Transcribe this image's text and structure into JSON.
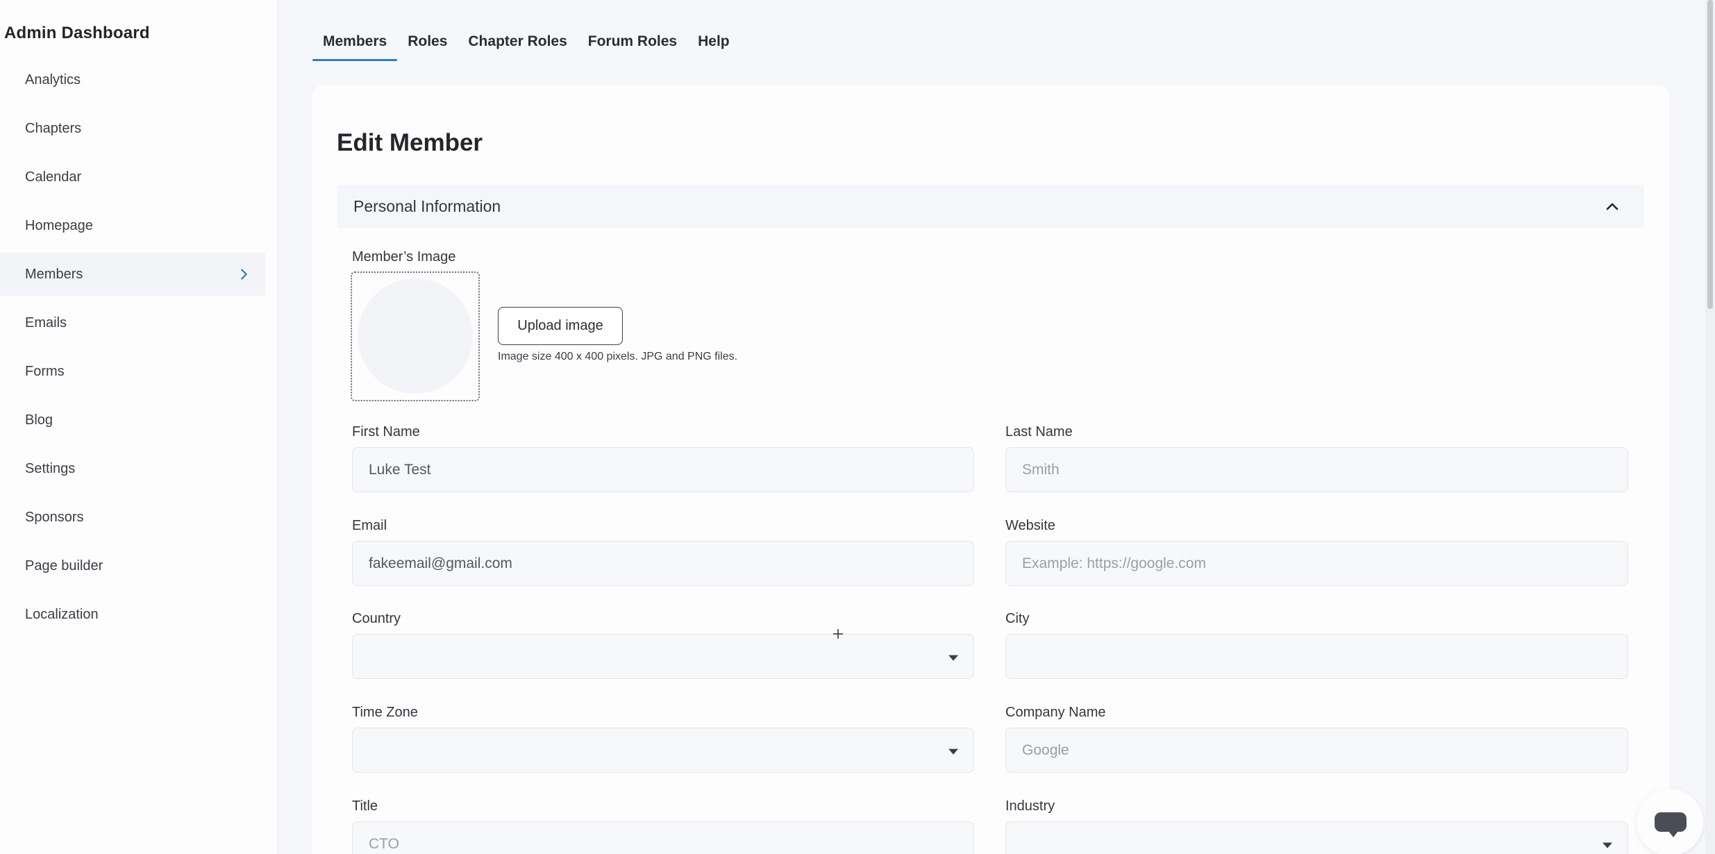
{
  "sidebar": {
    "title": "Admin Dashboard",
    "items": [
      {
        "label": "Analytics"
      },
      {
        "label": "Chapters"
      },
      {
        "label": "Calendar"
      },
      {
        "label": "Homepage"
      },
      {
        "label": "Members",
        "active": true
      },
      {
        "label": "Emails"
      },
      {
        "label": "Forms"
      },
      {
        "label": "Blog"
      },
      {
        "label": "Settings"
      },
      {
        "label": "Sponsors"
      },
      {
        "label": "Page builder"
      },
      {
        "label": "Localization"
      }
    ]
  },
  "tabs": [
    {
      "label": "Members",
      "active": true
    },
    {
      "label": "Roles"
    },
    {
      "label": "Chapter Roles"
    },
    {
      "label": "Forum Roles"
    },
    {
      "label": "Help"
    }
  ],
  "form": {
    "title": "Edit Member",
    "section_title": "Personal Information",
    "image_label": "Member’s Image",
    "upload_label": "Upload image",
    "image_hint": "Image size 400 x 400 pixels. JPG and PNG files.",
    "first_name": {
      "label": "First Name",
      "value": "Luke Test",
      "placeholder": ""
    },
    "last_name": {
      "label": "Last Name",
      "value": "",
      "placeholder": "Smith"
    },
    "email": {
      "label": "Email",
      "value": "fakeemail@gmail.com",
      "placeholder": ""
    },
    "website": {
      "label": "Website",
      "value": "",
      "placeholder": "Example: https://google.com"
    },
    "country": {
      "label": "Country",
      "value": ""
    },
    "city": {
      "label": "City",
      "value": "",
      "placeholder": ""
    },
    "time_zone": {
      "label": "Time Zone",
      "value": ""
    },
    "company_name": {
      "label": "Company Name",
      "value": "",
      "placeholder": "Google"
    },
    "title_field": {
      "label": "Title",
      "value": "",
      "placeholder": "CTO"
    },
    "industry": {
      "label": "Industry",
      "value": ""
    }
  },
  "colors": {
    "accent": "#2d7fc1",
    "background": "#f5f7fa",
    "card": "#fdfdfe"
  }
}
